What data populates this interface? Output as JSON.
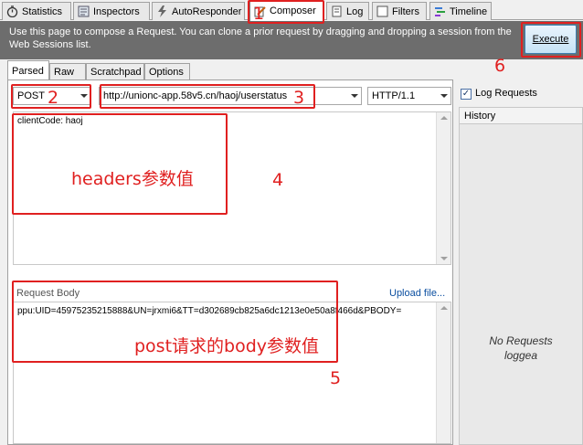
{
  "top_tabs": [
    {
      "label": "Statistics",
      "icon": "stopwatch-icon"
    },
    {
      "label": "Inspectors",
      "icon": "inspect-icon"
    },
    {
      "label": "AutoResponder",
      "icon": "lightning-icon"
    },
    {
      "label": "Composer",
      "icon": "pencil-icon",
      "active": true
    },
    {
      "label": "Log",
      "icon": "log-icon"
    },
    {
      "label": "Filters",
      "icon": "checkbox-icon"
    },
    {
      "label": "Timeline",
      "icon": "timeline-icon"
    }
  ],
  "info_text": "Use this page to compose a Request. You can clone a prior request by dragging and dropping a session from the Web Sessions list.",
  "execute_label": "Execute",
  "sub_tabs": [
    {
      "label": "Parsed",
      "active": true
    },
    {
      "label": "Raw"
    },
    {
      "label": "Scratchpad"
    },
    {
      "label": "Options"
    }
  ],
  "request": {
    "method": "POST",
    "url": "http://unionc-app.58v5.cn/haoj/userstatus",
    "protocol": "HTTP/1.1",
    "headers": "clientCode: haoj",
    "body_label": "Request Body",
    "upload_label": "Upload file...",
    "body": "ppu:UID=45975235215888&UN=jrxmi6&TT=d302689cb825a6dc1213e0e50a8f466d&PBODY="
  },
  "log_requests_label": "Log Requests",
  "log_requests_checked": true,
  "history_label": "History",
  "no_requests_line1": "No Requests",
  "no_requests_line2": "loggea",
  "annotations": {
    "n1": "1",
    "n2": "2",
    "n3": "3",
    "n4": "4",
    "n5": "5",
    "n6": "6",
    "headers_note": "headers参数值",
    "body_note": "post请求的body参数值"
  },
  "colors": {
    "annotation": "#e02020",
    "infobar": "#6d6d6d",
    "execute": "#c5e3f6"
  }
}
